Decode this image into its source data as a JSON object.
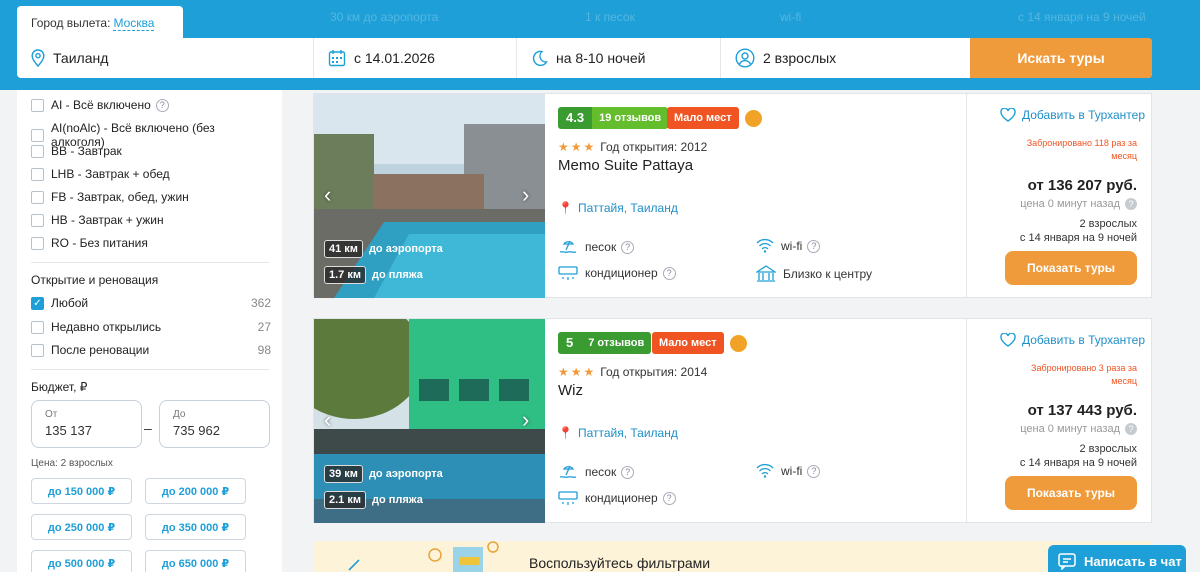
{
  "header": {
    "departure_label": "Город вылета:",
    "departure_city": "Москва",
    "destination": "Таиланд",
    "date": "с 14.01.2026",
    "nights": "на 8-10 ночей",
    "travellers": "2 взрослых",
    "search_button": "Искать туры",
    "ghost_left": "30 км до аэропорта",
    "ghost_mid": "1 к песок",
    "ghost_wifi": "wi-fi",
    "ghost_right": "с 14 января на 9 ночей"
  },
  "sidebar": {
    "meals": [
      {
        "label": "AI - Всё включено",
        "help": true
      },
      {
        "label": "AI(noAlc) - Всё включено (без алкоголя)"
      },
      {
        "label": "BB - Завтрак"
      },
      {
        "label": "LHB - Завтрак + обед"
      },
      {
        "label": "FB - Завтрак, обед, ужин"
      },
      {
        "label": "HB - Завтрак + ужин"
      },
      {
        "label": "RO - Без питания"
      }
    ],
    "opening_title": "Открытие и реновация",
    "opening": [
      {
        "label": "Любой",
        "count": "362",
        "checked": true
      },
      {
        "label": "Недавно открылись",
        "count": "27"
      },
      {
        "label": "После реновации",
        "count": "98"
      }
    ],
    "budget_title": "Бюджет, ₽",
    "budget_from_label": "От",
    "budget_from": "135 137",
    "budget_to_label": "До",
    "budget_to": "735 962",
    "budget_dash": "–",
    "price_note": "Цена: 2 взрослых",
    "price_chips": [
      "до 150 000 ₽",
      "до 200 000 ₽",
      "до 250 000 ₽",
      "до 350 000 ₽",
      "до 500 000 ₽",
      "до 650 000 ₽"
    ]
  },
  "hotels": [
    {
      "score": "4.3",
      "reviews": "19 отзывов",
      "badge": "Мало мест",
      "year": "Год открытия: 2012",
      "name": "Memo Suite Pattaya",
      "location": "Паттайя, Таиланд",
      "airport_km": "41 км",
      "airport_label": "до аэропорта",
      "beach_km": "1.7 км",
      "beach_label": "до пляжа",
      "amenities": [
        "песок",
        "wi-fi",
        "кондиционер",
        "Близко к центру"
      ],
      "favorite": "Добавить в Турхантер",
      "booked": "Забронировано 118 раз за месяц",
      "price": "от 136 207 руб.",
      "price_age": "цена 0 минут назад",
      "guests": "2 взрослых",
      "dates": "с 14 января на 9 ночей",
      "button": "Показать туры"
    },
    {
      "score": "5",
      "reviews": "7 отзывов",
      "badge": "Мало мест",
      "year": "Год открытия: 2014",
      "name": "Wiz",
      "location": "Паттайя, Таиланд",
      "airport_km": "39 км",
      "airport_label": "до аэропорта",
      "beach_km": "2.1 км",
      "beach_label": "до пляжа",
      "amenities": [
        "песок",
        "wi-fi",
        "кондиционер"
      ],
      "favorite": "Добавить в Турхантер",
      "booked": "Забронировано 3 раза за месяц",
      "price": "от 137 443 руб.",
      "price_age": "цена 0 минут назад",
      "guests": "2 взрослых",
      "dates": "с 14 января на 9 ночей",
      "button": "Показать туры"
    }
  ],
  "promo": {
    "text": "Воспользуйтесь фильтрами"
  },
  "chat": {
    "label": "Написать в чат"
  },
  "colors": {
    "accent": "#1e9fd8",
    "orange": "#f09b3b",
    "red": "#ef5422",
    "green": "#3a9b30"
  }
}
